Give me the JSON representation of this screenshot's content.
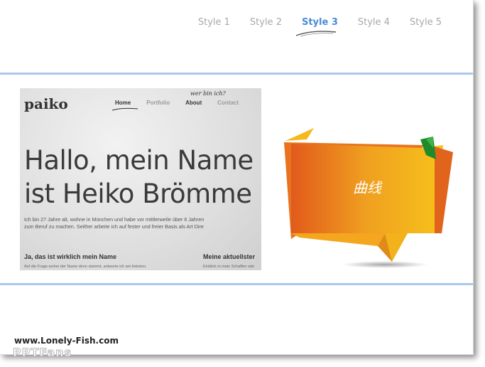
{
  "nav": {
    "items": [
      {
        "label": "Style 1"
      },
      {
        "label": "Style 2"
      },
      {
        "label": "Style 3"
      },
      {
        "label": "Style 4"
      },
      {
        "label": "Style 5"
      }
    ],
    "active_index": 2
  },
  "preview": {
    "logo": "paiko",
    "hand_note": "wer bin ich?",
    "nav": [
      "Home",
      "Portfolio",
      "About",
      "Contact"
    ],
    "headline_1": "Hallo, mein Name",
    "headline_2": "ist Heiko Brömme",
    "para_1": "Ich bin 27 Jahre alt, wohne in München und habe vor mittlerweile über 6 Jahren",
    "para_2": "zum Beruf zu machen. Seither arbeite ich auf fester und freier Basis als Art Dire",
    "col1_title": "Ja, das ist wirklich mein Name",
    "col1_text": "Auf die Frage woher der Name denn stammt, antworte ich am liebsten,",
    "col2_title": "Meine aktuellster",
    "col2_text": "Einblick in mein Schaffen ode"
  },
  "banner": {
    "label": "曲线"
  },
  "watermark": {
    "line1": "www.Lonely-Fish.com",
    "line2": "PPTFans"
  },
  "colors": {
    "accent": "#4a8bd6",
    "rule": "#a9c9ee",
    "banner_orange": "#e8731f",
    "banner_yellow": "#f6c21a",
    "ribbon_green": "#1f8a2a"
  }
}
